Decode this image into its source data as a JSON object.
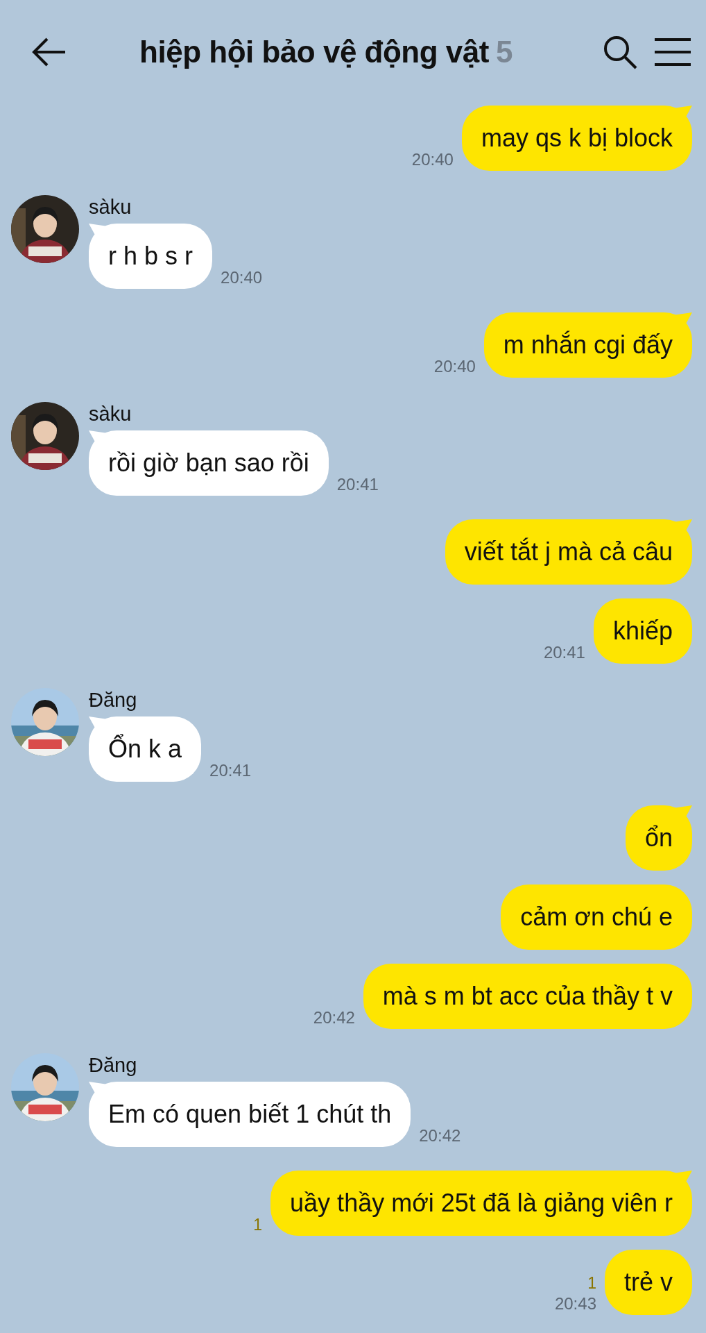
{
  "header": {
    "title": "hiệp hội bảo vệ động vật",
    "member_count": "5"
  },
  "groups": [
    {
      "kind": "outgoing",
      "messages": [
        {
          "text": "may qs k bị block",
          "time": "20:40"
        }
      ]
    },
    {
      "kind": "incoming",
      "name": "sàku",
      "avatar": {
        "kind": "picture"
      },
      "messages": [
        {
          "text": "r h b s r",
          "time": "20:40"
        }
      ]
    },
    {
      "kind": "outgoing",
      "messages": [
        {
          "text": "m nhắn cgi đấy",
          "time": "20:40"
        }
      ]
    },
    {
      "kind": "incoming",
      "name": "sàku",
      "avatar": {
        "kind": "picture"
      },
      "messages": [
        {
          "text": "rồi giờ bạn sao rồi",
          "time": "20:41"
        }
      ]
    },
    {
      "kind": "outgoing",
      "messages": [
        {
          "text": "viết tắt j mà cả câu"
        },
        {
          "text": "khiếp",
          "time": "20:41"
        }
      ]
    },
    {
      "kind": "incoming",
      "name": "Đăng",
      "avatar": {
        "kind": "picture"
      },
      "messages": [
        {
          "text": "Ổn k a",
          "time": "20:41"
        }
      ]
    },
    {
      "kind": "outgoing",
      "messages": [
        {
          "text": "ổn"
        },
        {
          "text": "cảm ơn chú e"
        },
        {
          "text": "mà s m bt acc của thầy t v",
          "time": "20:42"
        }
      ]
    },
    {
      "kind": "incoming",
      "name": "Đăng",
      "avatar": {
        "kind": "picture"
      },
      "messages": [
        {
          "text": "Em có quen biết 1 chút th",
          "time": "20:42"
        }
      ]
    },
    {
      "kind": "outgoing",
      "messages": [
        {
          "text": "uầy thầy mới 25t đã là giảng viên r",
          "unread": "1"
        },
        {
          "text": "trẻ v",
          "unread": "1",
          "time": "20:43"
        }
      ]
    }
  ]
}
